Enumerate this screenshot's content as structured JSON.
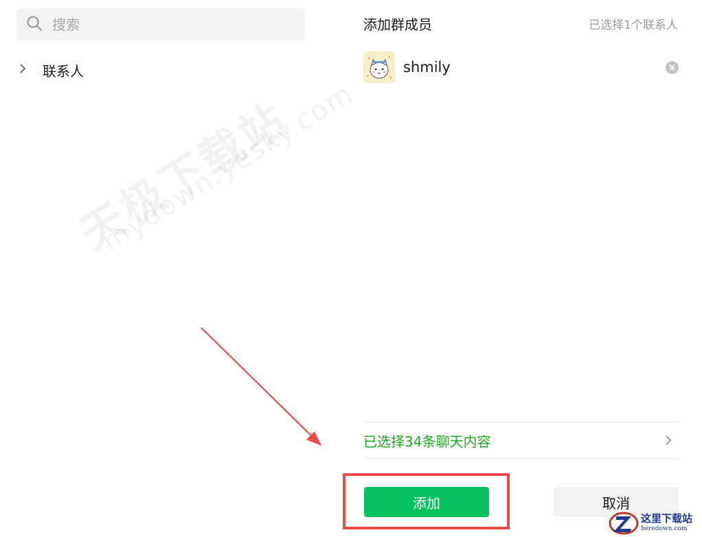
{
  "search": {
    "placeholder": "搜索",
    "icon": "search-icon"
  },
  "contacts_tree": {
    "group_label": "联系人",
    "expand_icon": "chevron-right-icon"
  },
  "watermark": {
    "line1": "天极下载站",
    "line2": "mydown.yesky.com"
  },
  "panel": {
    "title": "添加群成员",
    "selected_count": "已选择1个联系人",
    "members": [
      {
        "name": "shmily",
        "avatar_icon": "cartoon-cat-avatar",
        "remove_icon": "close-circle-icon"
      }
    ],
    "chat_selection": "已选择34条聊天内容",
    "chat_selection_icon": "chevron-right-icon"
  },
  "buttons": {
    "add_label": "添加",
    "cancel_label": "取消"
  },
  "colors": {
    "accent_green": "#07c160",
    "link_green": "#1aad19",
    "annotation_red": "#ea4a4a"
  },
  "logo": {
    "cn": "这里下载站",
    "en": "heredown.com"
  }
}
